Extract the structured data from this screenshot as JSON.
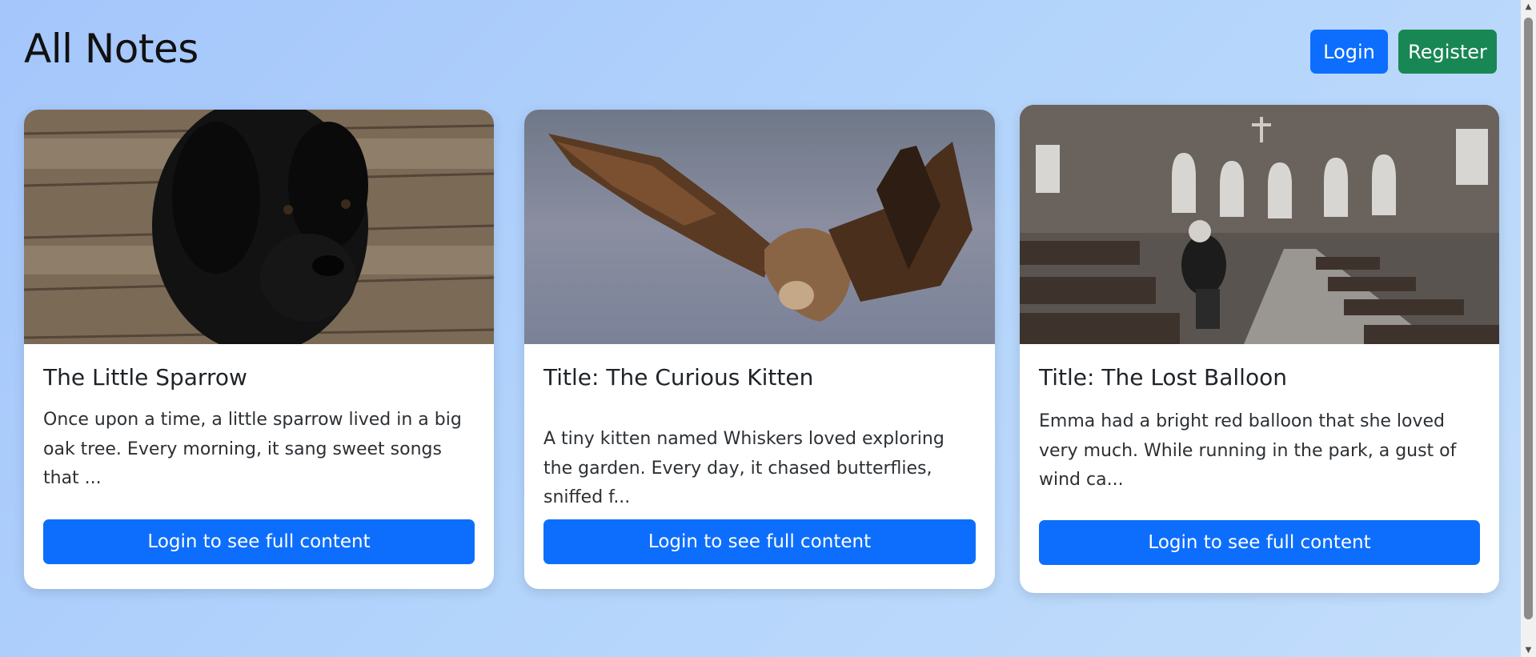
{
  "page": {
    "title": "All Notes"
  },
  "auth": {
    "login_label": "Login",
    "register_label": "Register"
  },
  "notes": [
    {
      "title": "The Little Sparrow",
      "text": "Once upon a time, a little sparrow lived in a big oak tree. Every morning, it sang sweet songs that ...",
      "button_label": "Login to see full content",
      "image": "black-puppy-photo"
    },
    {
      "title": "Title: The Curious Kitten",
      "text": "A tiny kitten named Whiskers loved exploring the garden. Every day, it chased butterflies, sniffed f...",
      "button_label": "Login to see full content",
      "image": "vulture-in-flight-photo"
    },
    {
      "title": "Title: The Lost Balloon",
      "text": "Emma had a bright red balloon that she loved very much. While running in the park, a gust of wind ca...",
      "button_label": "Login to see full content",
      "image": "church-interior-photo"
    }
  ],
  "colors": {
    "primary": "#0d6efd",
    "success": "#198754",
    "background": "#b3d4fb"
  }
}
